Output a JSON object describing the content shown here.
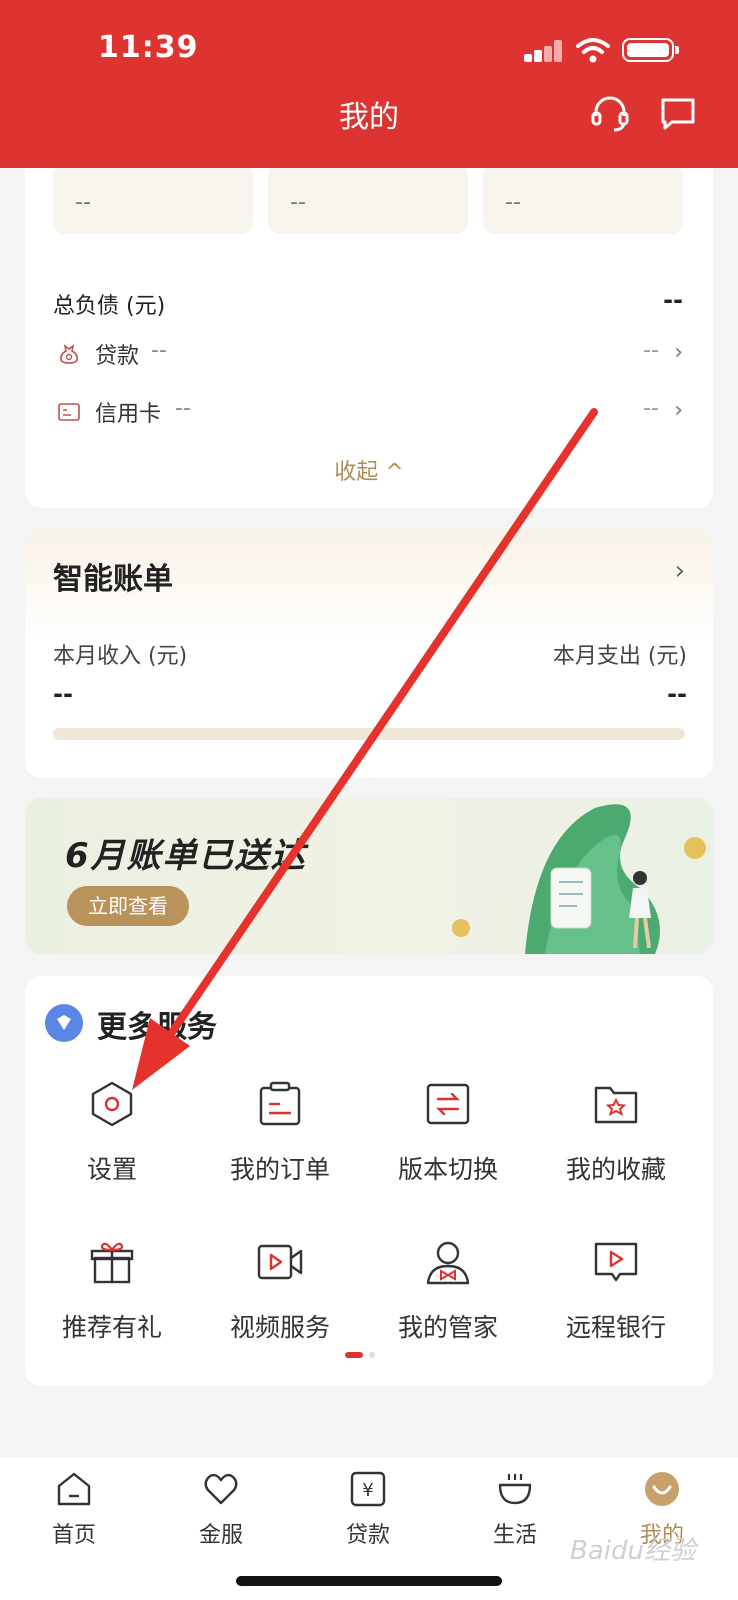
{
  "status_bar": {
    "time": "11:39"
  },
  "header": {
    "title": "我的"
  },
  "assets": {
    "boxes": [
      "--",
      "--",
      "--"
    ],
    "debt_title": "总负债 (元)",
    "debt_total": "--",
    "rows": [
      {
        "label": "贷款",
        "value": "--",
        "right_value": "--"
      },
      {
        "label": "信用卡",
        "value": "--",
        "right_value": "--"
      }
    ],
    "collapse_label": "收起 ^"
  },
  "bill": {
    "title": "智能账单",
    "income_label": "本月收入 (元)",
    "income_value": "--",
    "expense_label": "本月支出 (元)",
    "expense_value": "--"
  },
  "banner": {
    "title": "6月账单已送达",
    "button": "立即查看"
  },
  "services": {
    "title": "更多服务",
    "items": [
      {
        "label": "设置",
        "icon": "settings-hex-icon"
      },
      {
        "label": "我的订单",
        "icon": "order-icon"
      },
      {
        "label": "版本切换",
        "icon": "switch-icon"
      },
      {
        "label": "我的收藏",
        "icon": "favorites-icon"
      },
      {
        "label": "推荐有礼",
        "icon": "gift-icon"
      },
      {
        "label": "视频服务",
        "icon": "video-icon"
      },
      {
        "label": "我的管家",
        "icon": "butler-icon"
      },
      {
        "label": "远程银行",
        "icon": "remote-bank-icon"
      }
    ],
    "page_index": 1,
    "page_count": 2
  },
  "tabbar": {
    "items": [
      {
        "label": "首页"
      },
      {
        "label": "金服"
      },
      {
        "label": "贷款"
      },
      {
        "label": "生活"
      },
      {
        "label": "我的"
      }
    ],
    "active": "我的"
  },
  "colors": {
    "brand_red": "#de3431",
    "gold": "#b08c56",
    "annotation_arrow": "#e5322d"
  },
  "watermark": "Baidu经验"
}
